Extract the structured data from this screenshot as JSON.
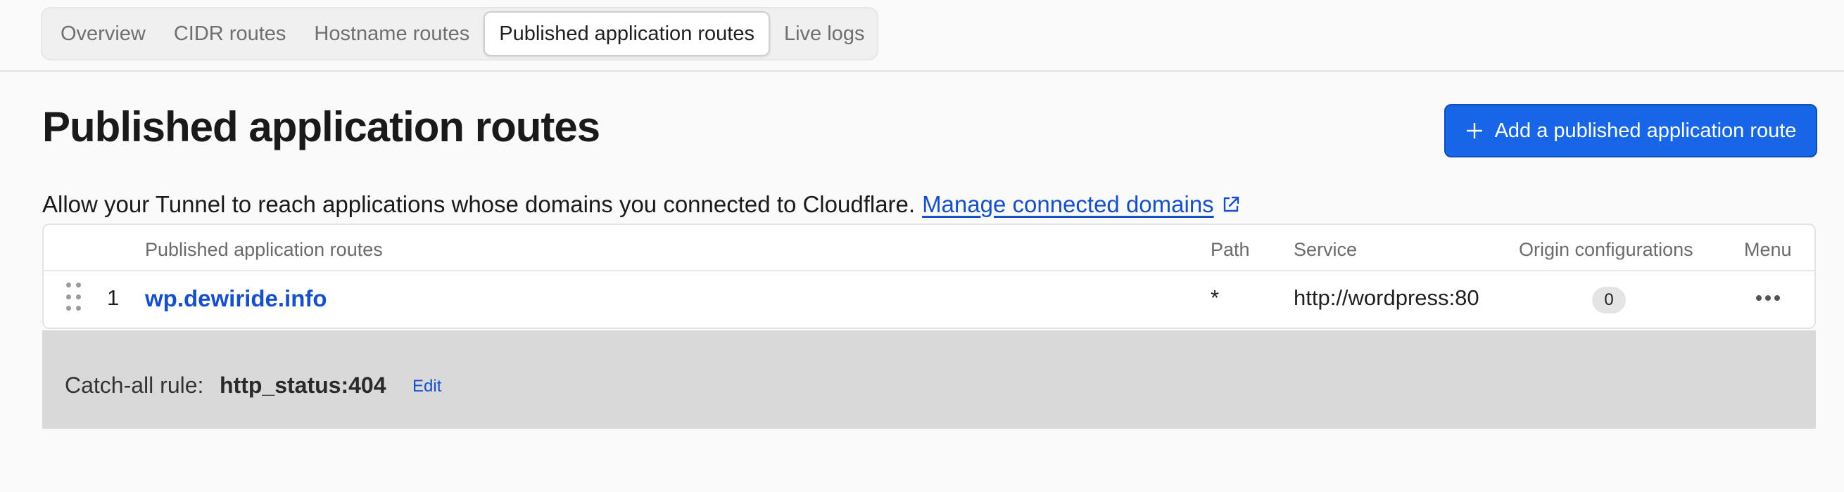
{
  "tabs": [
    {
      "label": "Overview",
      "active": false
    },
    {
      "label": "CIDR routes",
      "active": false
    },
    {
      "label": "Hostname routes",
      "active": false
    },
    {
      "label": "Published application routes",
      "active": true
    },
    {
      "label": "Live logs",
      "active": false
    }
  ],
  "page": {
    "title": "Published application routes",
    "add_button_label": "Add a published application route",
    "description": "Allow your Tunnel to reach applications whose domains you connected to Cloudflare.",
    "manage_link": "Manage connected domains"
  },
  "table": {
    "columns": {
      "routes": "Published application routes",
      "path": "Path",
      "service": "Service",
      "origin": "Origin configurations",
      "menu": "Menu"
    },
    "rows": [
      {
        "index": "1",
        "hostname": "wp.dewiride.info",
        "path": "*",
        "service": "http://wordpress:80",
        "origin_configurations": "0"
      }
    ]
  },
  "catch_all": {
    "label": "Catch-all rule:",
    "value": "http_status:404",
    "edit_label": "Edit"
  },
  "colors": {
    "accent": "#1766e8",
    "link": "#1650c8",
    "catch_all_bg": "#d9d9d9"
  },
  "icons": [
    "plus-icon",
    "external-link-icon",
    "drag-handle-icon",
    "more-options-icon"
  ]
}
